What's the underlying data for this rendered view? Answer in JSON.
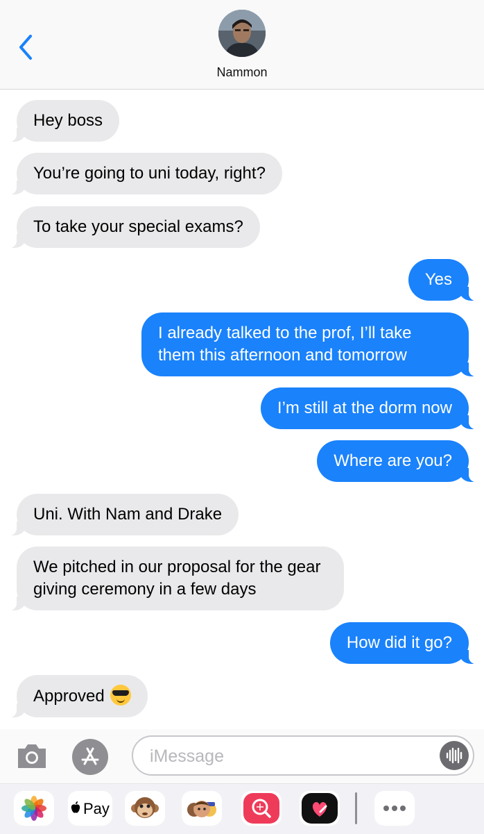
{
  "header": {
    "contact_name": "Nammon"
  },
  "messages": [
    {
      "from": "them",
      "text": "Hey boss"
    },
    {
      "from": "them",
      "text": "You’re going to uni today, right?"
    },
    {
      "from": "them",
      "text": "To take your special exams?"
    },
    {
      "from": "me",
      "text": "Yes"
    },
    {
      "from": "me",
      "text": "I already talked to the prof, I’ll take them this afternoon and tomorrow"
    },
    {
      "from": "me",
      "text": "I’m still at the dorm now"
    },
    {
      "from": "me",
      "text": "Where are you?"
    },
    {
      "from": "them",
      "text": "Uni. With Nam and Drake"
    },
    {
      "from": "them",
      "text": "We pitched in our proposal for the gear giving ceremony in a few days"
    },
    {
      "from": "me",
      "text": "How did it go?"
    },
    {
      "from": "them",
      "text": "Approved",
      "emoji": "sunglasses-face-emoji"
    }
  ],
  "input": {
    "placeholder": "iMessage",
    "value": ""
  },
  "app_drawer": {
    "items": [
      {
        "icon": "photos-icon"
      },
      {
        "icon": "apple-pay-icon",
        "label": "Pay"
      },
      {
        "icon": "animoji-monkey-icon"
      },
      {
        "icon": "memoji-stickers-icon"
      },
      {
        "icon": "image-search-icon"
      },
      {
        "icon": "digital-touch-icon"
      },
      {
        "icon": "more-apps-icon"
      }
    ]
  },
  "colors": {
    "sent_bubble": "#1a82fb",
    "received_bubble": "#e9e9eb",
    "accent": "#1a82fb"
  }
}
